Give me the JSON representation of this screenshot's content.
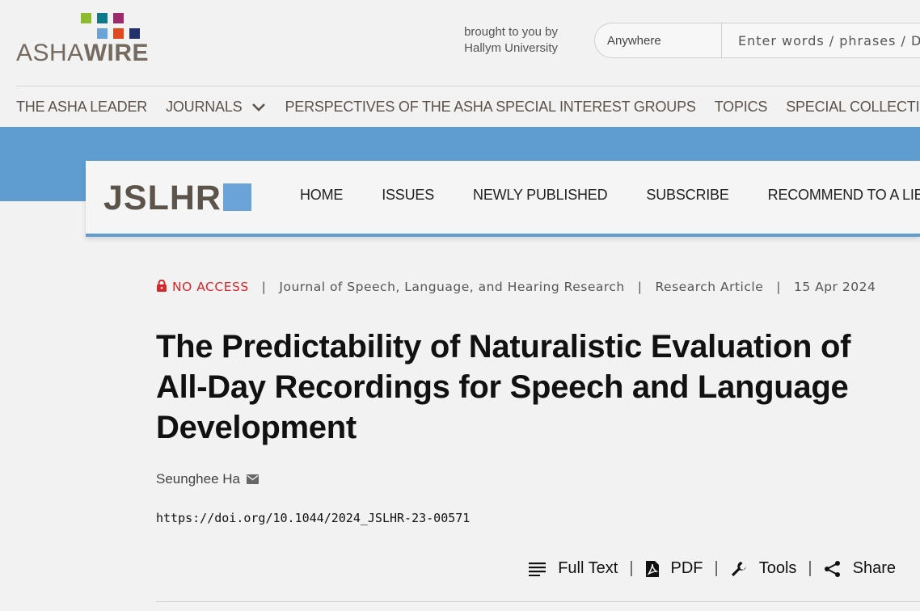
{
  "header": {
    "logo_text_light": "ASHA",
    "logo_text_bold": "WIRE",
    "logo_squares": [
      "#8cbb2e",
      "#0f7a8b",
      "#9e2a6e",
      "#6aa3d8",
      "#e0491f",
      "#23306e"
    ],
    "brought_by_line1": "brought to you by",
    "brought_by_line2": "Hallym University",
    "search": {
      "scope": "Anywhere",
      "placeholder": "Enter words / phrases / D"
    }
  },
  "main_nav": {
    "items": [
      "THE ASHA LEADER",
      "JOURNALS",
      "PERSPECTIVES OF THE ASHA SPECIAL INTEREST GROUPS",
      "TOPICS",
      "SPECIAL COLLECTIONS"
    ]
  },
  "journal_bar": {
    "logo": "JSLHR",
    "nav": [
      "HOME",
      "ISSUES",
      "NEWLY PUBLISHED",
      "SUBSCRIBE",
      "RECOMMEND TO A LIBR"
    ]
  },
  "article": {
    "access": "NO ACCESS",
    "journal": "Journal of Speech, Language, and Hearing Research",
    "type": "Research Article",
    "date": "15 Apr 2024",
    "title": "The Predictability of Naturalistic Evaluation of All-Day Recordings for Speech and Language Development",
    "author": "Seunghee Ha",
    "doi": "https://doi.org/10.1044/2024_JSLHR-23-00571",
    "actions": {
      "full_text": "Full Text",
      "pdf": "PDF",
      "tools": "Tools",
      "share": "Share"
    }
  },
  "colors": {
    "accent_blue": "#5f9dd1",
    "no_access_red": "#d7262a",
    "brand_brown": "#5c534b"
  }
}
